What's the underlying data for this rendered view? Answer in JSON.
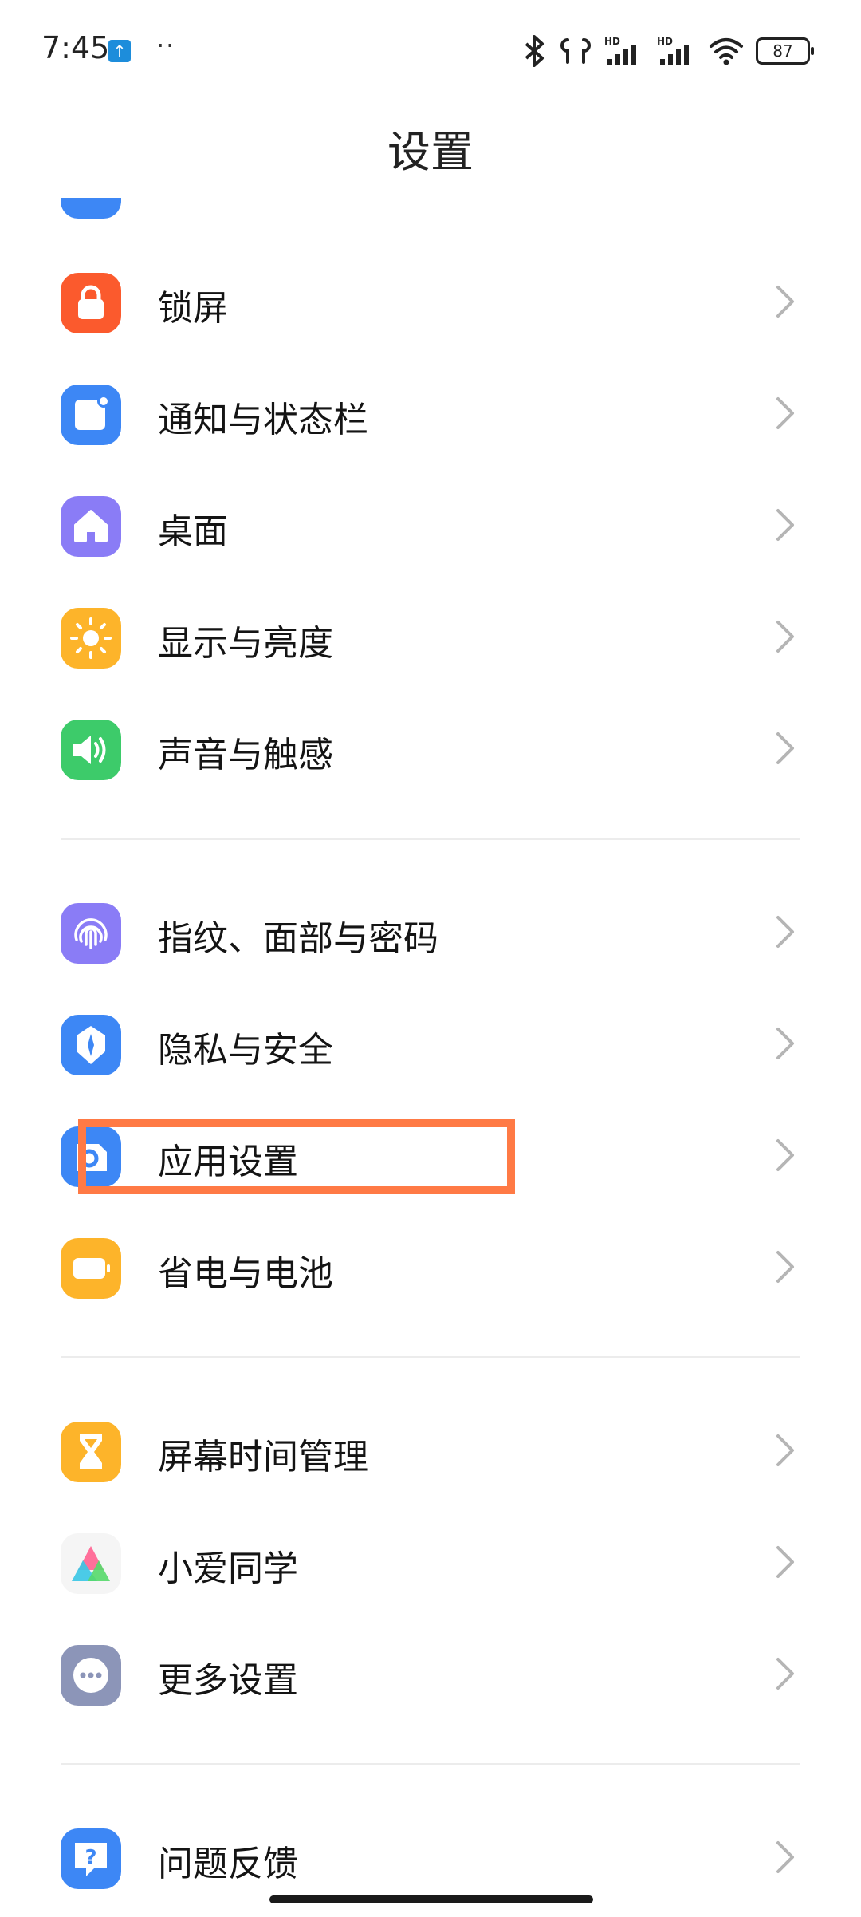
{
  "status_bar": {
    "time": "7:45",
    "dots": "··",
    "upload_badge_icon": "upload-arrow-icon",
    "battery": "87",
    "signal_hd_1": "HD",
    "signal_hd_2": "HD",
    "icons": [
      "bluetooth-icon",
      "earbuds-icon",
      "signal-icon",
      "signal-icon",
      "wifi-icon",
      "battery-icon"
    ]
  },
  "header": {
    "title": "设置"
  },
  "settings": {
    "items": [
      {
        "label": "锁屏",
        "icon": "lock-icon",
        "color": "#fb5a2d"
      },
      {
        "label": "通知与状态栏",
        "icon": "notification-icon",
        "color": "#3d87f5"
      },
      {
        "label": "桌面",
        "icon": "home-icon",
        "color": "#8a7cf6"
      },
      {
        "label": "显示与亮度",
        "icon": "sun-icon",
        "color": "#fdb42a"
      },
      {
        "label": "声音与触感",
        "icon": "speaker-icon",
        "color": "#3dcb6a"
      },
      {
        "label": "指纹、面部与密码",
        "icon": "fingerprint-icon",
        "color": "#8a7cf6"
      },
      {
        "label": "隐私与安全",
        "icon": "shield-icon",
        "color": "#3d87f5"
      },
      {
        "label": "应用设置",
        "icon": "apps-icon",
        "color": "#3d87f5"
      },
      {
        "label": "省电与电池",
        "icon": "battery-icon",
        "color": "#fdb42a"
      },
      {
        "label": "屏幕时间管理",
        "icon": "hourglass-icon",
        "color": "#fdb42a"
      },
      {
        "label": "小爱同学",
        "icon": "xiaoai-icon",
        "color": "#f5f5f5"
      },
      {
        "label": "更多设置",
        "icon": "more-icon",
        "color": "#8c95b8"
      },
      {
        "label": "问题反馈",
        "icon": "help-icon",
        "color": "#3d87f5"
      }
    ]
  },
  "highlight": {
    "target": "应用设置",
    "color": "#ff7a45"
  }
}
